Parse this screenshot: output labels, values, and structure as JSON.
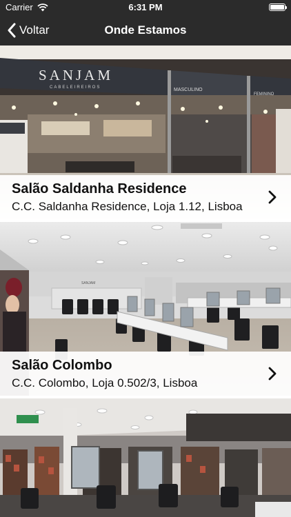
{
  "status_bar": {
    "carrier": "Carrier",
    "time": "6:31 PM",
    "wifi_icon": "wifi-icon",
    "battery_icon": "battery-icon"
  },
  "nav": {
    "back_label": "Voltar",
    "back_icon": "chevron-left-icon",
    "title": "Onde Estamos"
  },
  "colors": {
    "navbar": "#2b2b2b",
    "text": "#111111",
    "info_panel": "#ffffff"
  },
  "locations": [
    {
      "name": "Salão Saldanha Residence",
      "address": "C.C. Saldanha Residence, Loja 1.12, Lisboa",
      "sign_brand": "SANJAM",
      "sign_sub": "CABELEIREIROS",
      "sign_section_1": "MASCULINO",
      "sign_section_2": "FEMININO"
    },
    {
      "name": "Salão Colombo",
      "address": "C.C. Colombo, Loja 0.502/3, Lisboa",
      "sign_brand": "SANJAM"
    },
    {
      "name": "",
      "address": ""
    }
  ],
  "row_icon": "chevron-right-icon"
}
